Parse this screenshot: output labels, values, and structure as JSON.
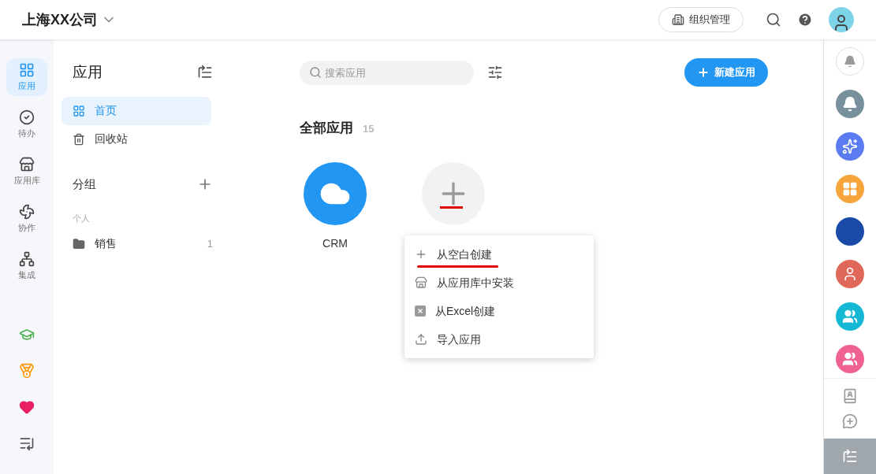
{
  "header": {
    "company": "上海XX公司",
    "org_button": "组织管理"
  },
  "left_rail": {
    "items": [
      {
        "label": "应用",
        "kind": "apps",
        "selected": true
      },
      {
        "label": "待办",
        "kind": "todo",
        "selected": false
      },
      {
        "label": "应用库",
        "kind": "store",
        "selected": false
      },
      {
        "label": "协作",
        "kind": "pinwheel",
        "selected": false
      },
      {
        "label": "集成",
        "kind": "hub",
        "selected": false
      }
    ],
    "bottom_icons": [
      {
        "kind": "cap"
      },
      {
        "kind": "medal"
      },
      {
        "kind": "heart"
      },
      {
        "kind": "expand"
      }
    ]
  },
  "sidebar": {
    "title": "应用",
    "items": [
      {
        "label": "首页",
        "kind": "grid",
        "selected": true
      },
      {
        "label": "回收站",
        "kind": "trash",
        "selected": false
      }
    ],
    "group_title": "分组",
    "group_section": "个人",
    "groups": [
      {
        "label": "销售",
        "count": "1"
      }
    ]
  },
  "main": {
    "search": {
      "placeholder": "搜索应用"
    },
    "new_button": "新建应用",
    "section_title": "全部应用",
    "section_count": "15",
    "apps": [
      {
        "name": "CRM",
        "kind": "cloud"
      },
      {
        "kind": "add"
      }
    ],
    "menu": [
      {
        "label": "从空白创建",
        "kind": "plus",
        "annotated": true
      },
      {
        "label": "从应用库中安装",
        "kind": "store",
        "annotated": false
      },
      {
        "label": "从Excel创建",
        "kind": "excel",
        "annotated": false
      },
      {
        "label": "导入应用",
        "kind": "upload",
        "annotated": false
      }
    ]
  },
  "right_rail": {
    "items": [
      {
        "kind": "bell-outline",
        "color": "#ffffff"
      },
      {
        "kind": "bell",
        "color": "#78909c"
      },
      {
        "kind": "spark",
        "color": "#5b7cf0"
      },
      {
        "kind": "grid",
        "color": "#f5a53c"
      },
      {
        "kind": "photo",
        "color": "#1a4aa8"
      },
      {
        "kind": "person",
        "color": "#e0685a"
      },
      {
        "kind": "group",
        "color": "#14b8d4"
      },
      {
        "kind": "group",
        "color": "#f06292"
      }
    ],
    "bottom_icons": [
      {
        "kind": "contacts"
      },
      {
        "kind": "chat-add"
      },
      {
        "kind": "collapse"
      }
    ]
  }
}
